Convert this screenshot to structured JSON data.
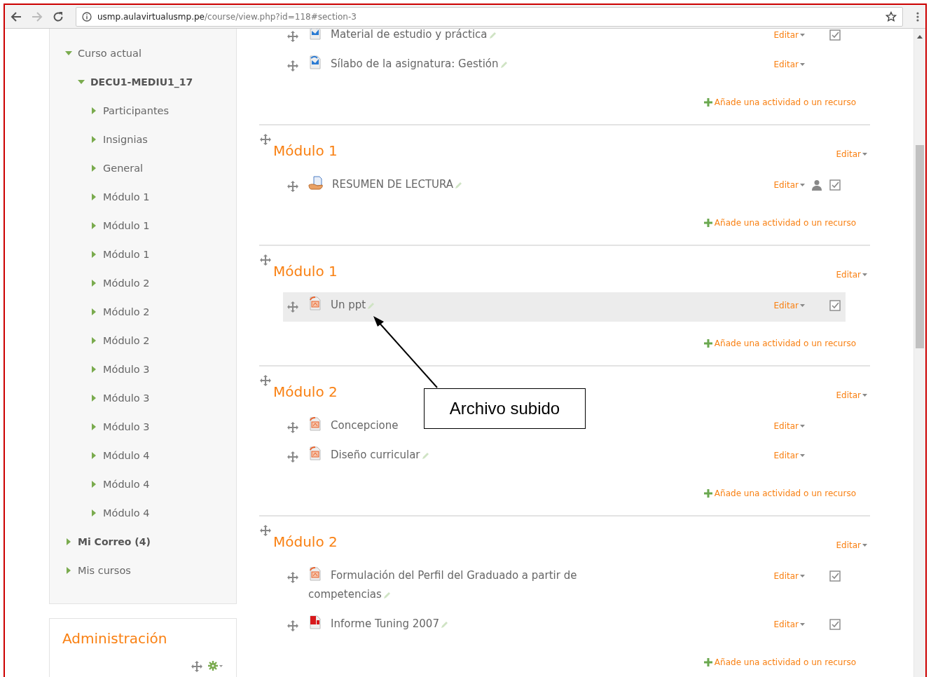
{
  "browser": {
    "url_host": "usmp.aulavirtualusmp.pe",
    "url_path": "/course/view.php?id=118#section-3"
  },
  "sidebar": {
    "items": [
      {
        "label": "Curso actual",
        "expanded": true,
        "bold": false,
        "children": [
          {
            "label": "DECU1-MEDIU1_17",
            "expanded": true,
            "bold": true,
            "children": [
              {
                "label": "Participantes",
                "expanded": false,
                "bold": false
              },
              {
                "label": "Insignias",
                "expanded": false,
                "bold": false
              },
              {
                "label": "General",
                "expanded": false,
                "bold": false
              },
              {
                "label": "Módulo 1",
                "expanded": false,
                "bold": false
              },
              {
                "label": "Módulo 1",
                "expanded": false,
                "bold": false
              },
              {
                "label": "Módulo 1",
                "expanded": false,
                "bold": false
              },
              {
                "label": "Módulo 2",
                "expanded": false,
                "bold": false
              },
              {
                "label": "Módulo 2",
                "expanded": false,
                "bold": false
              },
              {
                "label": "Módulo 2",
                "expanded": false,
                "bold": false
              },
              {
                "label": "Módulo 3",
                "expanded": false,
                "bold": false
              },
              {
                "label": "Módulo 3",
                "expanded": false,
                "bold": false
              },
              {
                "label": "Módulo 3",
                "expanded": false,
                "bold": false
              },
              {
                "label": "Módulo 4",
                "expanded": false,
                "bold": false
              },
              {
                "label": "Módulo 4",
                "expanded": false,
                "bold": false
              },
              {
                "label": "Módulo 4",
                "expanded": false,
                "bold": false
              }
            ]
          }
        ]
      },
      {
        "label": "Mi Correo (4)",
        "expanded": false,
        "bold": true
      },
      {
        "label": "Mis cursos",
        "expanded": false,
        "bold": false
      }
    ]
  },
  "admin_block": {
    "title": "Administración"
  },
  "sections": [
    {
      "activities": [
        {
          "kind": "url",
          "name": "Material de estudio y práctica",
          "editable": true,
          "edit": "Editar",
          "group_mode": false,
          "completion": true,
          "highlighted": false
        },
        {
          "kind": "url",
          "name": "Sílabo de la asignatura: Gestión",
          "editable": true,
          "edit": "Editar",
          "group_mode": false,
          "completion": false,
          "highlighted": false
        }
      ],
      "add_link": "Añade una actividad o un recurso"
    },
    {
      "title": "Módulo 1",
      "edit": "Editar",
      "activities": [
        {
          "kind": "assignment",
          "name": "RESUMEN DE LECTURA",
          "editable": true,
          "edit": "Editar",
          "group_mode": true,
          "completion": true,
          "highlighted": false
        }
      ],
      "add_link": "Añade una actividad o un recurso"
    },
    {
      "title": "Módulo 1",
      "edit": "Editar",
      "activities": [
        {
          "kind": "powerpoint",
          "name": "Un ppt",
          "editable": true,
          "edit": "Editar",
          "group_mode": false,
          "completion": true,
          "highlighted": true
        }
      ],
      "add_link": "Añade una actividad o un recurso"
    },
    {
      "title": "Módulo 2",
      "edit": "Editar",
      "activities": [
        {
          "kind": "powerpoint",
          "name": "Concepcione",
          "editable": false,
          "edit": "Editar",
          "group_mode": false,
          "completion": false,
          "highlighted": false
        },
        {
          "kind": "powerpoint",
          "name": "Diseño curricular",
          "editable": true,
          "edit": "Editar",
          "group_mode": false,
          "completion": false,
          "highlighted": false
        }
      ],
      "add_link": "Añade una actividad o un recurso"
    },
    {
      "title": "Módulo 2",
      "edit": "Editar",
      "activities": [
        {
          "kind": "powerpoint",
          "name": "Formulación del Perfil del Graduado a partir de competencias",
          "editable": true,
          "edit": "Editar",
          "group_mode": false,
          "completion": true,
          "highlighted": false
        },
        {
          "kind": "pdf",
          "name": "Informe Tuning 2007",
          "editable": true,
          "edit": "Editar",
          "group_mode": false,
          "completion": true,
          "highlighted": false
        }
      ],
      "add_link": "Añade una actividad o un recurso"
    }
  ],
  "callout": {
    "text": "Archivo subido"
  }
}
